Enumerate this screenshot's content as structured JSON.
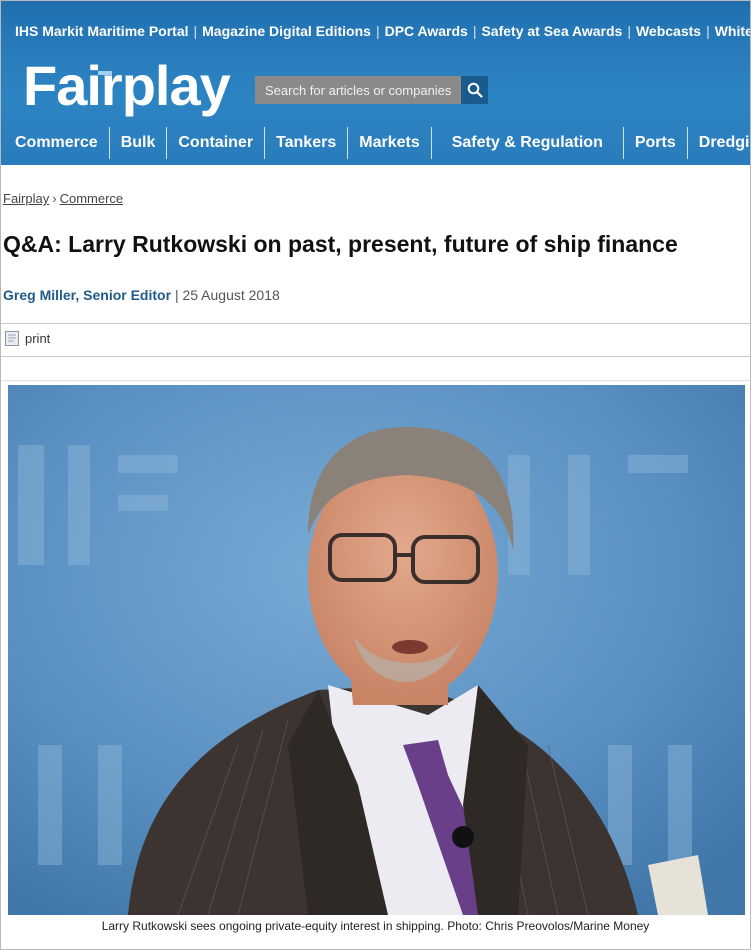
{
  "header": {
    "top_links": [
      "IHS Markit Maritime Portal",
      "Magazine Digital Editions",
      "DPC Awards",
      "Safety at Sea Awards",
      "Webcasts",
      "Whitepape"
    ],
    "logo": "Fairplay",
    "search_placeholder": "Search for articles or companies",
    "nav": [
      "Commerce",
      "Bulk",
      "Container",
      "Tankers",
      "Markets",
      "Safety & Regulation",
      "Ports",
      "Dredging"
    ]
  },
  "breadcrumb": {
    "home": "Fairplay",
    "section": "Commerce"
  },
  "article": {
    "title": "Q&A: Larry Rutkowski on past, present, future of ship finance",
    "author": "Greg Miller, Senior Editor",
    "date": "25 August 2018",
    "print_label": "print",
    "caption": "Larry Rutkowski sees ongoing private-equity interest in shipping. Photo: Chris Preovolos/Marine Money"
  },
  "colors": {
    "header_blue": "#2a7dbd",
    "search_button": "#1a5b8f",
    "author_blue": "#1f5a8a"
  },
  "icons": {
    "search": "magnifier-icon",
    "print": "document-icon"
  }
}
